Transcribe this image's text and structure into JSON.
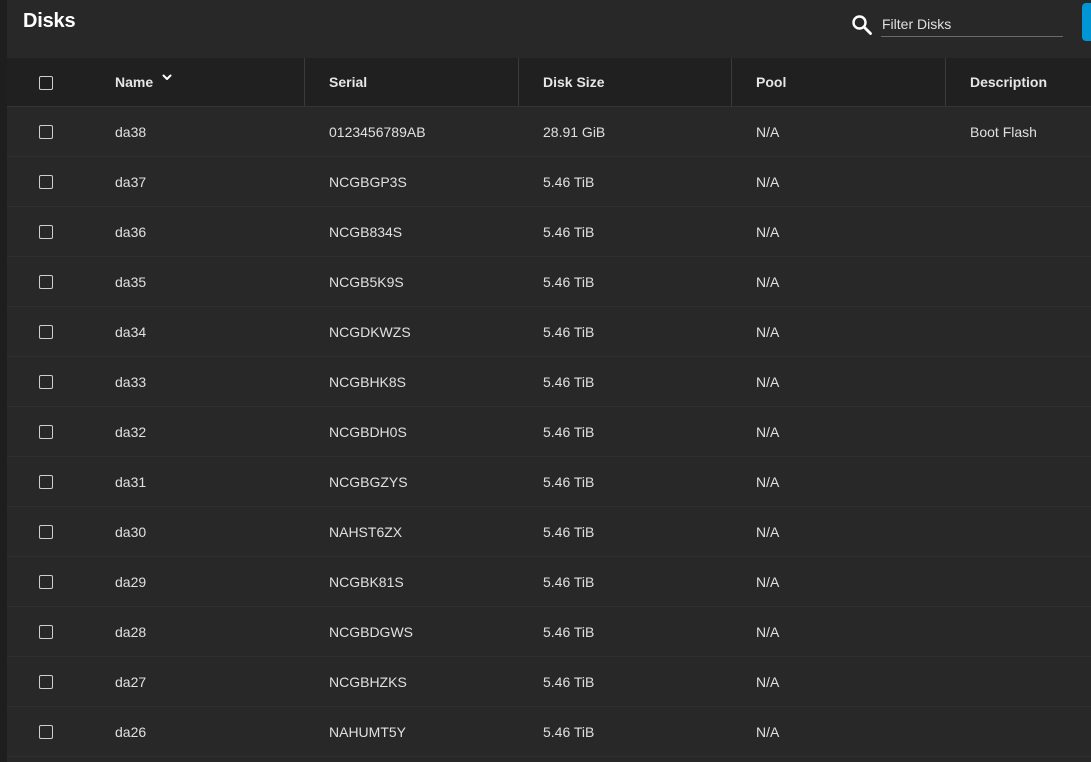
{
  "header": {
    "title": "Disks",
    "search_icon": "search-icon",
    "filter_placeholder": "Filter Disks",
    "accent_color": "#0095d5"
  },
  "table": {
    "columns": {
      "name": "Name",
      "serial": "Serial",
      "disk_size": "Disk Size",
      "pool": "Pool",
      "description": "Description"
    },
    "sort_column": "Name",
    "sort_icon": "chevron-down-icon",
    "rows": [
      {
        "name": "da38",
        "serial": "0123456789AB",
        "disk_size": "28.91 GiB",
        "pool": "N/A",
        "description": "Boot Flash"
      },
      {
        "name": "da37",
        "serial": "NCGBGP3S",
        "disk_size": "5.46 TiB",
        "pool": "N/A",
        "description": ""
      },
      {
        "name": "da36",
        "serial": "NCGB834S",
        "disk_size": "5.46 TiB",
        "pool": "N/A",
        "description": ""
      },
      {
        "name": "da35",
        "serial": "NCGB5K9S",
        "disk_size": "5.46 TiB",
        "pool": "N/A",
        "description": ""
      },
      {
        "name": "da34",
        "serial": "NCGDKWZS",
        "disk_size": "5.46 TiB",
        "pool": "N/A",
        "description": ""
      },
      {
        "name": "da33",
        "serial": "NCGBHK8S",
        "disk_size": "5.46 TiB",
        "pool": "N/A",
        "description": ""
      },
      {
        "name": "da32",
        "serial": "NCGBDH0S",
        "disk_size": "5.46 TiB",
        "pool": "N/A",
        "description": ""
      },
      {
        "name": "da31",
        "serial": "NCGBGZYS",
        "disk_size": "5.46 TiB",
        "pool": "N/A",
        "description": ""
      },
      {
        "name": "da30",
        "serial": "NAHST6ZX",
        "disk_size": "5.46 TiB",
        "pool": "N/A",
        "description": ""
      },
      {
        "name": "da29",
        "serial": "NCGBK81S",
        "disk_size": "5.46 TiB",
        "pool": "N/A",
        "description": ""
      },
      {
        "name": "da28",
        "serial": "NCGBDGWS",
        "disk_size": "5.46 TiB",
        "pool": "N/A",
        "description": ""
      },
      {
        "name": "da27",
        "serial": "NCGBHZKS",
        "disk_size": "5.46 TiB",
        "pool": "N/A",
        "description": ""
      },
      {
        "name": "da26",
        "serial": "NAHUMT5Y",
        "disk_size": "5.46 TiB",
        "pool": "N/A",
        "description": ""
      }
    ]
  }
}
